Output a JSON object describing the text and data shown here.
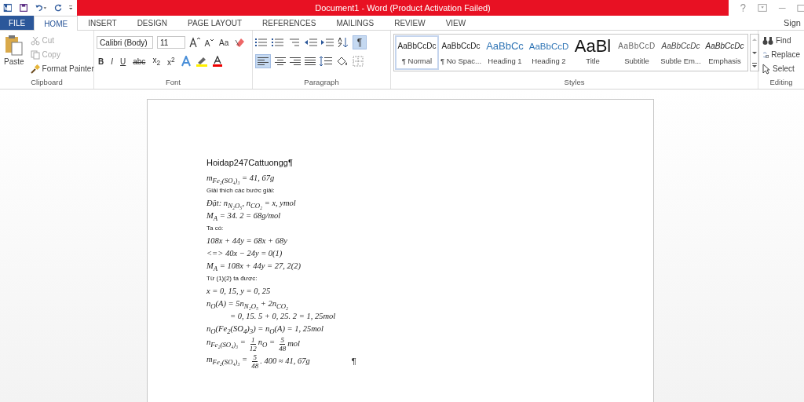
{
  "window": {
    "title": "Document1 - Word (Product Activation Failed)",
    "sign_in": "Sign"
  },
  "tabs": [
    {
      "label": "FILE",
      "kind": "file",
      "selected": false
    },
    {
      "label": "HOME",
      "kind": "tab",
      "selected": true
    },
    {
      "label": "INSERT",
      "kind": "tab",
      "selected": false
    },
    {
      "label": "DESIGN",
      "kind": "tab",
      "selected": false
    },
    {
      "label": "PAGE LAYOUT",
      "kind": "tab",
      "selected": false
    },
    {
      "label": "REFERENCES",
      "kind": "tab",
      "selected": false
    },
    {
      "label": "MAILINGS",
      "kind": "tab",
      "selected": false
    },
    {
      "label": "REVIEW",
      "kind": "tab",
      "selected": false
    },
    {
      "label": "VIEW",
      "kind": "tab",
      "selected": false
    }
  ],
  "clipboard": {
    "label": "Clipboard",
    "paste": "Paste",
    "cut": "Cut",
    "copy": "Copy",
    "format_painter": "Format Painter"
  },
  "font": {
    "label": "Font",
    "family": "Calibri (Body)",
    "size": "11",
    "change_case": "Aa",
    "bold": "B",
    "italic": "I",
    "underline": "U",
    "strikethrough": "abc",
    "subscript": "x$_{2}$",
    "superscript": "x$^{2}$"
  },
  "paragraph": {
    "label": "Paragraph",
    "show_marks": {
      "symbol": "¶",
      "on": true
    },
    "align_left": {
      "on": true
    }
  },
  "styles": {
    "label": "Styles",
    "items": [
      {
        "preview": "AaBbCcDc",
        "name": "¶ Normal",
        "kind": "normal",
        "selected": true
      },
      {
        "preview": "AaBbCcDc",
        "name": "¶ No Spac...",
        "kind": "normal",
        "selected": false
      },
      {
        "preview": "AaBbCc",
        "name": "Heading 1",
        "kind": "heading1",
        "selected": false
      },
      {
        "preview": "AaBbCcD",
        "name": "Heading 2",
        "kind": "heading2",
        "selected": false
      },
      {
        "preview": "AaBl",
        "name": "Title",
        "kind": "title",
        "selected": false
      },
      {
        "preview": "AaBbCcD",
        "name": "Subtitle",
        "kind": "subtitle",
        "selected": false
      },
      {
        "preview": "AaBbCcDc",
        "name": "Subtle Em...",
        "kind": "subtle",
        "selected": false
      },
      {
        "preview": "AaBbCcDc",
        "name": "Emphasis",
        "kind": "emphasis",
        "selected": false
      }
    ]
  },
  "editing": {
    "label": "Editing",
    "find": "Find",
    "replace": "Replace",
    "select": "Select"
  },
  "document": {
    "heading": "Hoidap247Cattuongg¶",
    "lines": [
      {
        "kind": "math",
        "text": "m$_{Fe₂(SO₄)₃}$ = 41, 67g"
      },
      {
        "kind": "text",
        "text": "Giải thích các bước giải:"
      },
      {
        "kind": "math",
        "text": "Đặt: n$_{N₂O₅}$, n$_{CO₂}$ = x, ymol"
      },
      {
        "kind": "math",
        "text": "M$_{A}$ = 34. 2 = 68g/mol"
      },
      {
        "kind": "text",
        "text": "Ta có:"
      },
      {
        "kind": "math",
        "text": "108x + 44y = 68x + 68y"
      },
      {
        "kind": "math",
        "text": "<=> 40x − 24y = 0(1)"
      },
      {
        "kind": "math",
        "text": "M$_{A}$ = 108x + 44y = 27, 2(2)"
      },
      {
        "kind": "text",
        "text": "Từ (1)(2) ta được:"
      },
      {
        "kind": "math",
        "text": "x = 0, 15, y = 0, 25"
      },
      {
        "kind": "math",
        "text": "n$_{O}$(A) = 5n$_{N₂O₅}$ + 2n$_{CO₂}$"
      },
      {
        "kind": "indent",
        "text": "= 0, 15. 5 + 0, 25. 2 = 1, 25mol"
      },
      {
        "kind": "math",
        "text": "n$_{O}$(Fe$_{2}$(SO$_{4}$)$_{3}$) = n$_{O}$(A) = 1, 25mol"
      },
      {
        "kind": "fraction",
        "segments": [
          {
            "text": "n$_{Fe₂(SO₄)₃}$ ="
          },
          {
            "num": "1",
            "den": "12"
          },
          {
            "text": "n$_{O}$ ="
          },
          {
            "num": "5",
            "den": "48"
          },
          {
            "text": "mol"
          }
        ]
      },
      {
        "kind": "fraction",
        "segments": [
          {
            "text": "m$_{Fe₂(SO₄)₃}$ ="
          },
          {
            "num": "5",
            "den": "48"
          },
          {
            "text": ". 400 ≈ 41, 67g"
          }
        ],
        "end_mark": "¶"
      }
    ]
  }
}
